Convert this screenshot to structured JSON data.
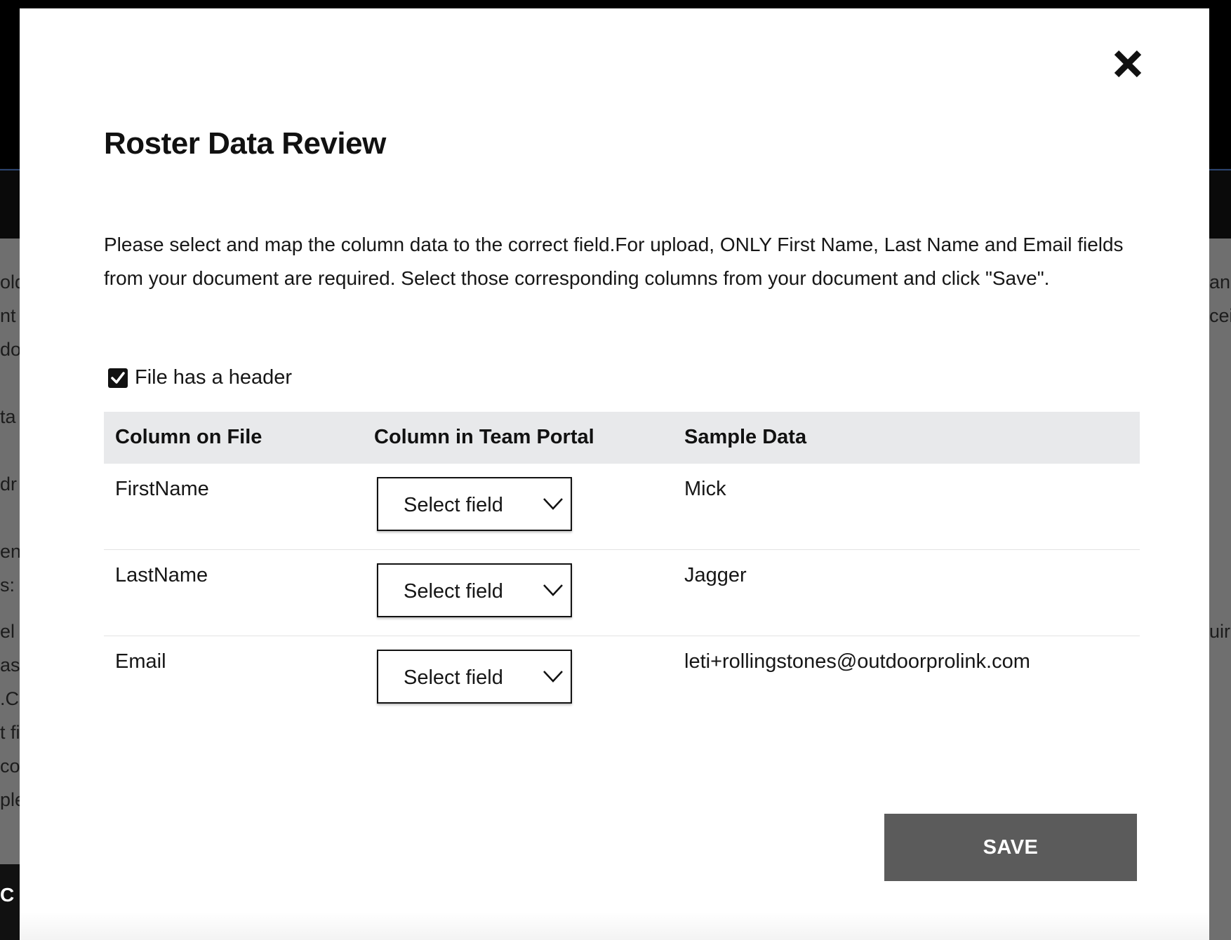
{
  "background": {
    "left_fragments": [
      "old",
      "nt",
      "do",
      "ta",
      "dr",
      "en",
      "s:",
      "el",
      "as",
      ".C",
      "t fi",
      "co",
      "ple"
    ],
    "right_fragments": [
      "an",
      "cei",
      "uir"
    ],
    "bottom_fragment": "C"
  },
  "modal": {
    "close_label": "X",
    "title": "Roster Data Review",
    "description": "Please select and map the column data to the correct field.For upload, ONLY First Name, Last Name and Email fields from your document are required. Select those corresponding columns from your document and click \"Save\".",
    "header_checkbox": {
      "label": "File has a header",
      "checked": true
    },
    "table": {
      "headers": {
        "file_column": "Column on File",
        "portal_column": "Column in Team Portal",
        "sample": "Sample Data"
      },
      "rows": [
        {
          "file_column": "FirstName",
          "selected": "Select field",
          "sample": "Mick"
        },
        {
          "file_column": "LastName",
          "selected": "Select field",
          "sample": "Jagger"
        },
        {
          "file_column": "Email",
          "selected": "Select field",
          "sample": "leti+rollingstones@outdoorprolink.com"
        }
      ]
    },
    "save_label": "SAVE"
  },
  "colors": {
    "overlay": "#6f6f6f",
    "table_header_bg": "#e8e9eb",
    "save_button_bg": "#5b5b5b",
    "text": "#161616"
  }
}
